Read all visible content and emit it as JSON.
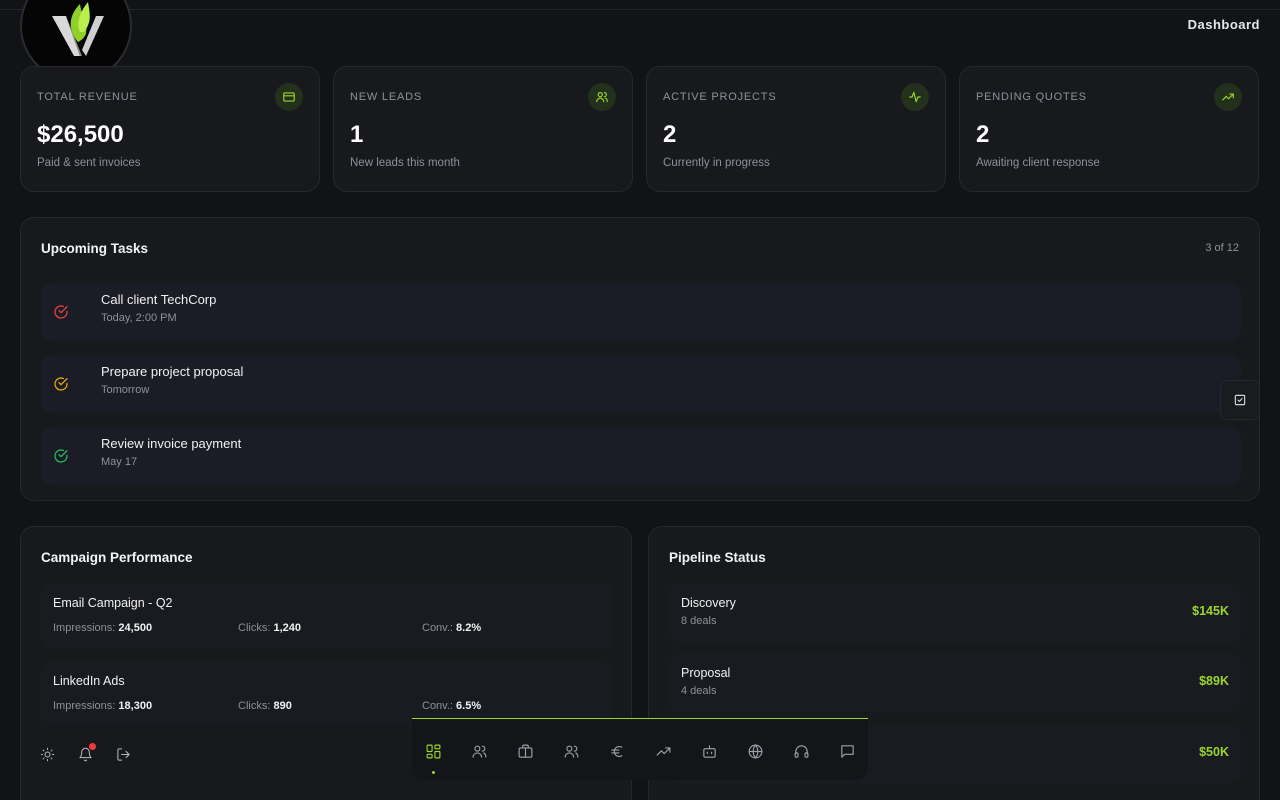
{
  "header": {
    "title": "Dashboard"
  },
  "stats": [
    {
      "label": "TOTAL REVENUE",
      "value": "$26,500",
      "sub": "Paid & sent invoices",
      "icon": "credit-card-icon"
    },
    {
      "label": "NEW LEADS",
      "value": "1",
      "sub": "New leads this month",
      "icon": "users-icon"
    },
    {
      "label": "ACTIVE PROJECTS",
      "value": "2",
      "sub": "Currently in progress",
      "icon": "activity-icon"
    },
    {
      "label": "PENDING QUOTES",
      "value": "2",
      "sub": "Awaiting client response",
      "icon": "trending-up-icon"
    }
  ],
  "tasks": {
    "title": "Upcoming Tasks",
    "count": "3 of 12",
    "items": [
      {
        "name": "Call client TechCorp",
        "when": "Today, 2:00 PM",
        "color": "#ef4444"
      },
      {
        "name": "Prepare project proposal",
        "when": "Tomorrow",
        "color": "#eab308"
      },
      {
        "name": "Review invoice payment",
        "when": "May 17",
        "color": "#22c55e"
      }
    ]
  },
  "campaign": {
    "title": "Campaign Performance",
    "items": [
      {
        "name": "Email Campaign - Q2",
        "impressions_label": "Impressions:",
        "impressions": "24,500",
        "clicks_label": "Clicks:",
        "clicks": "1,240",
        "conv_label": "Conv.:",
        "conv": "8.2%"
      },
      {
        "name": "LinkedIn Ads",
        "impressions_label": "Impressions:",
        "impressions": "18,300",
        "clicks_label": "Clicks:",
        "clicks": "890",
        "conv_label": "Conv.:",
        "conv": "6.5%"
      }
    ]
  },
  "pipeline": {
    "title": "Pipeline Status",
    "items": [
      {
        "name": "Discovery",
        "deals": "8 deals",
        "amount": "$145K"
      },
      {
        "name": "Proposal",
        "deals": "4 deals",
        "amount": "$89K"
      },
      {
        "name": "",
        "deals": "",
        "amount": "$50K"
      }
    ]
  },
  "dock": {
    "accent": "#9ad52c",
    "items": [
      "dashboard-icon",
      "users-icon",
      "briefcase-icon",
      "team-icon",
      "euro-icon",
      "trending-up-icon",
      "bot-icon",
      "globe-icon",
      "headset-icon",
      "message-icon"
    ]
  },
  "colors": {
    "accent": "#9ad52c",
    "background": "#121316",
    "card": "#18191d"
  }
}
